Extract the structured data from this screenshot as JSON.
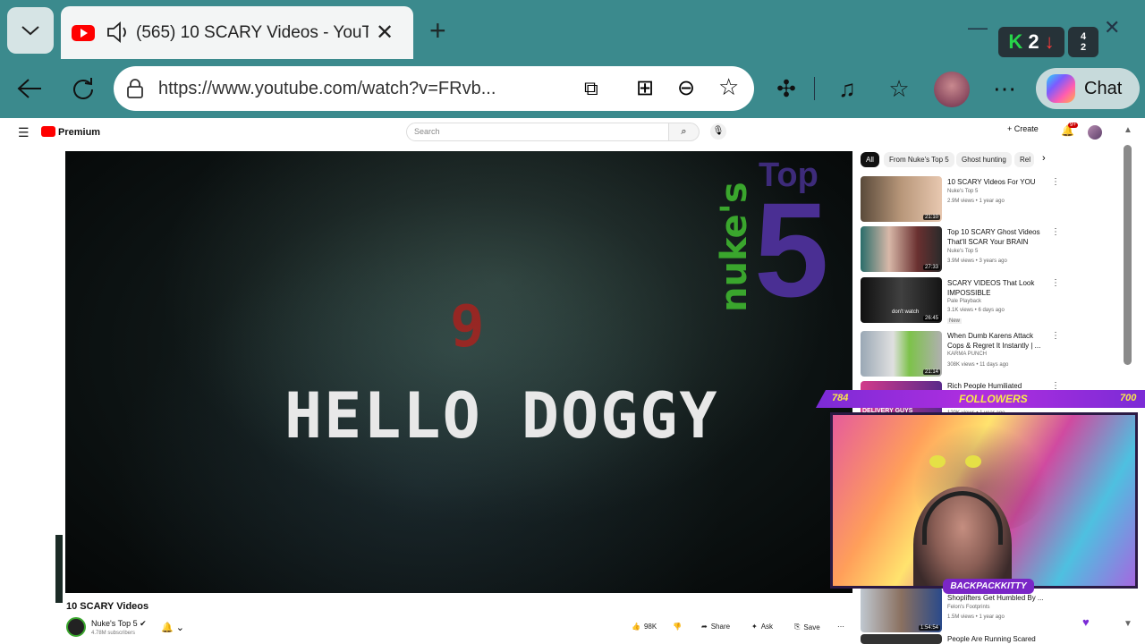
{
  "browser": {
    "tab": {
      "title": "(565) 10 SCARY Videos - YouT"
    },
    "address": {
      "url": "https://www.youtube.com/watch?v=FRvb..."
    },
    "chat_label": "Chat",
    "extension_badge": {
      "k_count": "2",
      "stack_top": "4",
      "stack_bottom": "2"
    }
  },
  "youtube": {
    "brand": "Premium",
    "search_placeholder": "Search",
    "create_label": "Create",
    "notifications": "9+",
    "video": {
      "number_overlay": "9",
      "caption": "HELLO DOGGY",
      "brand_overlay_nukes": "nuke's",
      "brand_overlay_top": "Top",
      "brand_overlay_five": "5",
      "title": "10 SCARY Videos",
      "channel": "Nuke's Top 5",
      "subscribers": "4.78M subscribers",
      "likes": "98K",
      "share": "Share",
      "ask": "Ask",
      "save": "Save"
    },
    "chips": [
      "All",
      "From Nuke's Top 5",
      "Ghost hunting",
      "Rel"
    ],
    "related": [
      {
        "title": "10 SCARY Videos For YOU",
        "channel": "Nuke's Top 5",
        "meta": "2.9M views • 1 year ago",
        "duration": "21:10"
      },
      {
        "title": "Top 10 SCARY Ghost Videos That'll SCAR Your BRAIN",
        "channel": "Nuke's Top 5",
        "meta": "3.9M views • 3 years ago",
        "duration": "27:33"
      },
      {
        "title": "SCARY VIDEOS That Look IMPOSSIBLE",
        "channel": "Pale Playback",
        "meta": "3.1K views • 6 days ago",
        "badge": "New",
        "duration": "26:45",
        "thumb_text": "don't watch"
      },
      {
        "title": "When Dumb Karens Attack Cops & Regret It Instantly | ...",
        "channel": "KARMA PUNCH",
        "meta": "308K views • 11 days ago",
        "duration": "21:14"
      },
      {
        "title": "Rich People Humiliated Delivery",
        "channel": "",
        "meta": "120K views • 1 year ago",
        "thumb_text": "DELIVERY GUYS"
      },
      {
        "title": "Shoplifters Get Humbled By ...",
        "channel": "Felon's Footprints",
        "meta": "1.5M views • 1 year ago",
        "duration": "1:54:54"
      },
      {
        "title": "People Are Running Scared",
        "channel": "",
        "meta": ""
      }
    ]
  },
  "stream_overlay": {
    "followers_left": "784",
    "followers_label": "FOLLOWERS",
    "followers_right": "700",
    "streamer_name": "BACKPACKKITTY"
  },
  "colors": {
    "browser_chrome": "#3b8a8d",
    "youtube_red": "#ff0000",
    "overlay_purple": "#7b2bd6",
    "overlay_yellow": "#f9e94a"
  }
}
